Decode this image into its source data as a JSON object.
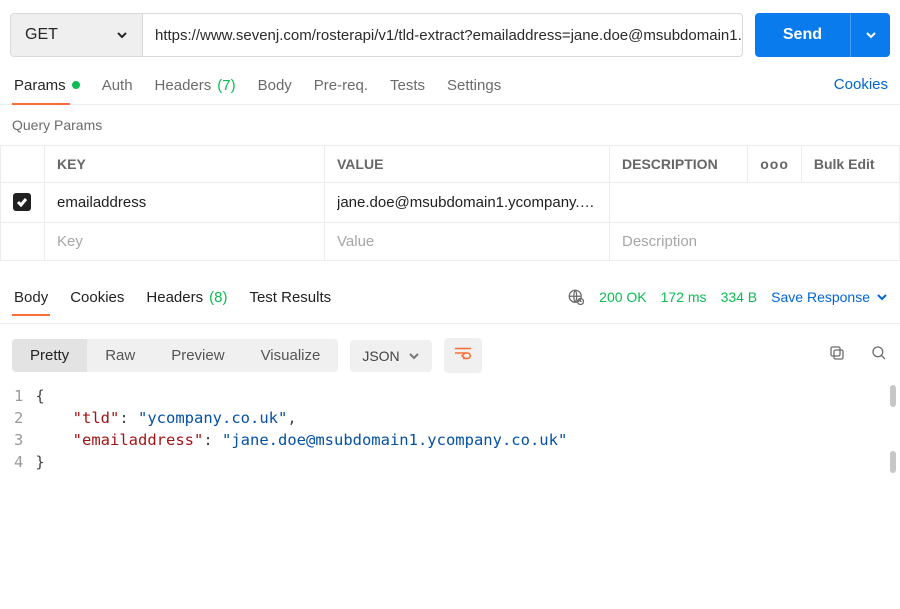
{
  "method": "GET",
  "url": "https://www.sevenj.com/rosterapi/v1/tld-extract?emailaddress=jane.doe@msubdomain1.…",
  "send_label": "Send",
  "tabs": {
    "params": "Params",
    "auth": "Auth",
    "headers": "Headers",
    "headers_count": "(7)",
    "body": "Body",
    "prereq": "Pre-req.",
    "tests": "Tests",
    "settings": "Settings",
    "cookies": "Cookies"
  },
  "section": "Query Params",
  "table": {
    "head_key": "KEY",
    "head_value": "VALUE",
    "head_desc": "DESCRIPTION",
    "bulk_edit": "Bulk Edit",
    "more": "ooo",
    "row1": {
      "key": "emailaddress",
      "value": "jane.doe@msubdomain1.ycompany.co.…"
    },
    "placeholder": {
      "key": "Key",
      "value": "Value",
      "desc": "Description"
    }
  },
  "resp_tabs": {
    "body": "Body",
    "cookies": "Cookies",
    "headers": "Headers",
    "headers_count": "(8)",
    "test_results": "Test Results"
  },
  "status": {
    "code": "200 OK",
    "time": "172 ms",
    "size": "334 B"
  },
  "save_response": "Save Response",
  "view_modes": {
    "pretty": "Pretty",
    "raw": "Raw",
    "preview": "Preview",
    "visualize": "Visualize"
  },
  "format_select": "JSON",
  "response_json": {
    "tld": "ycompany.co.uk",
    "emailaddress": "jane.doe@msubdomain1.ycompany.co.uk"
  },
  "chart_data": {
    "type": "table",
    "note": "no chart in image"
  }
}
